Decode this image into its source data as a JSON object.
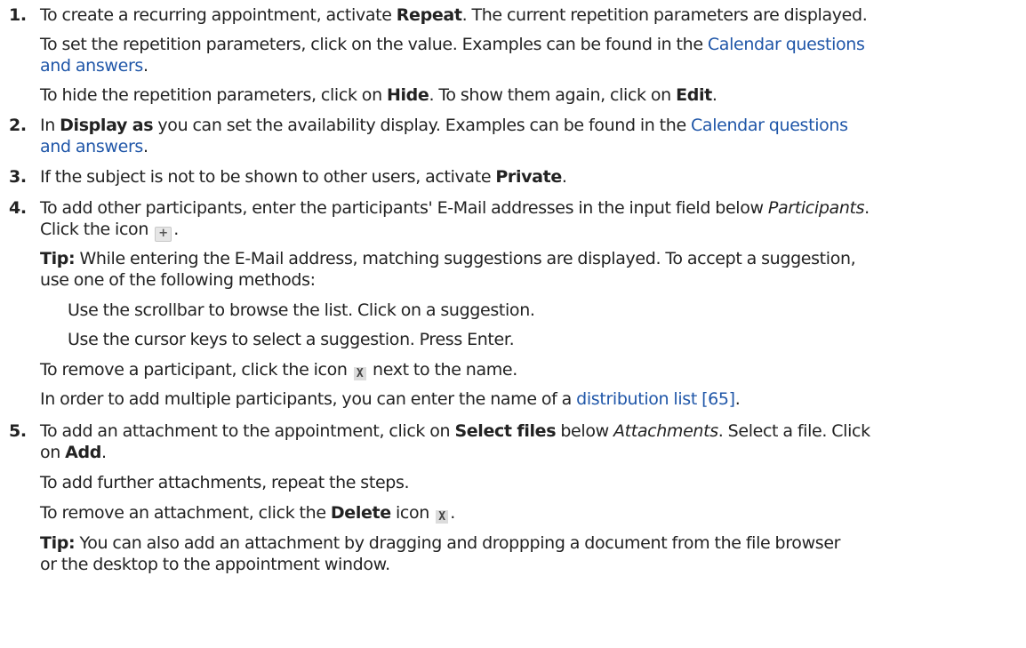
{
  "steps": [
    {
      "number": "1.",
      "l1": {
        "a": "To create a recurring appointment, activate ",
        "b": "Repeat",
        "c": ". The current repetition parameters are displayed."
      },
      "l2": {
        "a": "To set the repetition parameters, click on the value. Examples can be found in the ",
        "link": "Calendar questions"
      },
      "l3": {
        "link": "and answers",
        "c": "."
      },
      "l4": {
        "a": "To hide the repetition parameters, click on ",
        "b": "Hide",
        "c": ". To show them again, click on ",
        "d": "Edit",
        "e": "."
      }
    },
    {
      "number": "2.",
      "l1": {
        "a": "In ",
        "b": "Display as",
        "c": " you can set the availability display. Examples can be found in the ",
        "link": "Calendar questions"
      },
      "l2": {
        "link": "and answers",
        "c": "."
      }
    },
    {
      "number": "3.",
      "l1": {
        "a": "If the subject is not to be shown to other users, activate ",
        "b": "Private",
        "c": "."
      }
    },
    {
      "number": "4.",
      "l1": {
        "a": "To add other participants, enter the participants' E-Mail addresses in the input field below ",
        "i": "Participants",
        "c": "."
      },
      "l2": {
        "a": "Click the icon ",
        "icon": "+",
        "c": "."
      },
      "tip1": {
        "label": "Tip:",
        "text": " While entering the E-Mail address, matching suggestions are displayed. To accept a suggestion,"
      },
      "tip2": "use one of the following methods:",
      "method1": "Use the scrollbar to browse the list. Click on a suggestion.",
      "method2": "Use the cursor keys to select a suggestion. Press Enter.",
      "remove": {
        "a": "To remove a participant, click the icon ",
        "icon": "X",
        "c": " next to the name."
      },
      "multi": {
        "a": "In order to add multiple participants, you can enter the name of a ",
        "link": "distribution list [65]",
        "c": "."
      }
    },
    {
      "number": "5.",
      "l1": {
        "a": "To add an attachment to the appointment, click on ",
        "b": "Select files",
        "c": " below ",
        "i": "Attachments",
        "d": ". Select a file. Click"
      },
      "l2": {
        "a": "on ",
        "b": "Add",
        "c": "."
      },
      "further": "To add further attachments, repeat the steps.",
      "remove": {
        "a": "To remove an attachment, click the ",
        "b": "Delete",
        "c": " icon ",
        "icon": "X",
        "d": "."
      },
      "tip1": {
        "label": "Tip:",
        "text": " You can also add an attachment by dragging and droppping a document from the file browser"
      },
      "tip2": "or the desktop to the appointment window."
    }
  ],
  "colors": {
    "link": "#1f56a8",
    "text": "#222222"
  },
  "icons": {
    "add": "add-icon",
    "remove": "delete-x-icon"
  }
}
